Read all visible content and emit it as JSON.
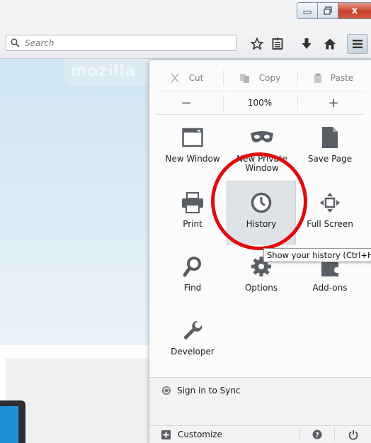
{
  "search": {
    "placeholder": "Search"
  },
  "logo": "mozilla",
  "edit": {
    "cut": "Cut",
    "copy": "Copy",
    "paste": "Paste"
  },
  "zoom": {
    "out": "−",
    "level": "100%",
    "in": "+"
  },
  "grid": {
    "new_window": "New Window",
    "new_private_window": "New Private Window",
    "save_page": "Save Page",
    "print": "Print",
    "history": "History",
    "full_screen": "Full Screen",
    "find": "Find",
    "options": "Options",
    "addons": "Add-ons",
    "developer": "Developer"
  },
  "tooltip": "Show your history (Ctrl+H)",
  "footer": {
    "sync": "Sign in to Sync",
    "customize": "Customize"
  },
  "window_buttons": {
    "close": "x"
  },
  "colors": {
    "highlight_circle": "#e10b0b",
    "close_button": "#c9402b"
  }
}
